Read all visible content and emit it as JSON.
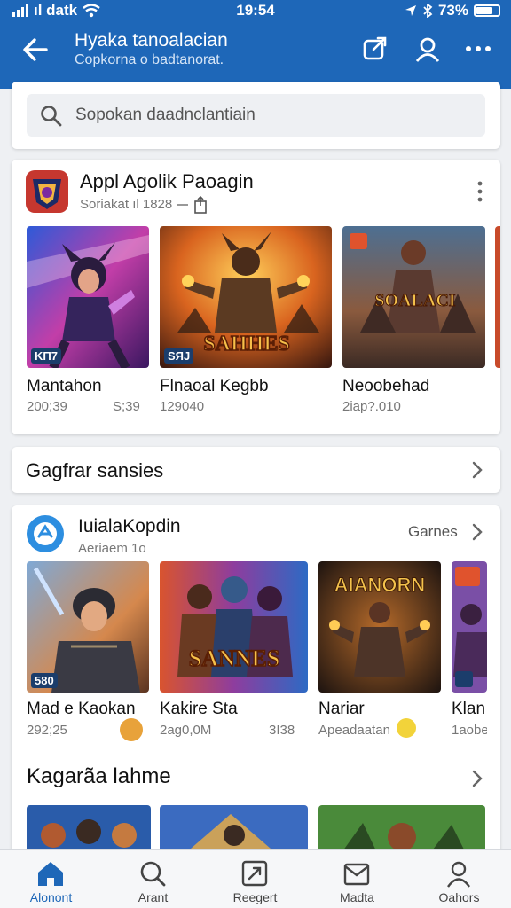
{
  "status_bar": {
    "carrier": "ıl datk",
    "time": "19:54",
    "battery": "73%"
  },
  "header": {
    "title": "Hyaka tanoalacian",
    "subtitle": "Copkorna o badtanorat.",
    "icons": [
      "back-arrow-icon",
      "edit-share-icon",
      "account-icon",
      "more-icon"
    ]
  },
  "search": {
    "placeholder": "Sopokan daadnclantiain"
  },
  "section1": {
    "title": "Appl Agolik Paoagin",
    "subtitle": "Soriakat ıl 1828",
    "items": [
      {
        "name": "Mantahon",
        "meta_left": "200;39",
        "meta_right": "S;39",
        "badge": "ΚΠ7"
      },
      {
        "name": "Flnaoal Kegbb",
        "meta_left": "129040",
        "meta_right": "",
        "badge": "SЯJ",
        "art_text": "SAHHES"
      },
      {
        "name": "Neoobehad",
        "meta_left": "2iap?.010",
        "meta_right": "",
        "badge": "",
        "art_text": "SOALACI"
      }
    ]
  },
  "section2": {
    "title": "Gagfrar sansies"
  },
  "section3": {
    "title": "IuialaKopdin",
    "subtitle": "Aeriaem 1o",
    "action": "Garnes",
    "items": [
      {
        "name": "Mad e Kaokan",
        "meta_left": "292;25",
        "meta_right": "",
        "badge": "580"
      },
      {
        "name": "Kakire Sta",
        "meta_left": "2ag0,0M",
        "meta_right": "3I38",
        "art_text": "SANNES"
      },
      {
        "name": "Nariar",
        "meta_left": "Apeadaatan",
        "meta_right": "",
        "art_text": "AIANORN"
      },
      {
        "name": "Klan",
        "meta_left": "1aobe",
        "meta_right": ""
      }
    ]
  },
  "section4": {
    "title": "Kagarãa  lahme"
  },
  "bottom_nav": [
    {
      "label": "Alonont",
      "icon": "home-icon",
      "active": true
    },
    {
      "label": "Arant",
      "icon": "search-icon",
      "active": false
    },
    {
      "label": "Reegert",
      "icon": "updates-icon",
      "active": false
    },
    {
      "label": "Madta",
      "icon": "inbox-icon",
      "active": false
    },
    {
      "label": "Oahors",
      "icon": "profile-icon",
      "active": false
    }
  ],
  "colors": {
    "brand": "#1e67b8",
    "background": "#eef0f3",
    "card": "#ffffff"
  }
}
